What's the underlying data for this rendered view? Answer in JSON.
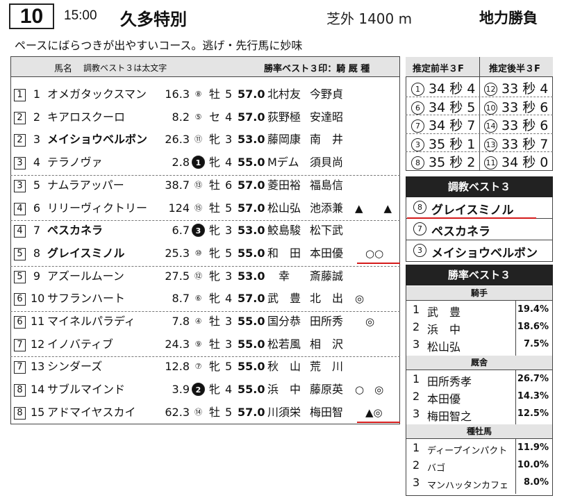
{
  "header": {
    "race_number": "10",
    "time": "15:00",
    "race_name": "久多特別",
    "course": "芝外 1400 m",
    "condition": "地力勝負"
  },
  "comment": "ペースにばらつきが出やすいコース。逃げ・先行馬に妙味",
  "table_head": {
    "left": "馬名",
    "left_sub": "調教ベスト３は太文字",
    "right": "勝率ベスト３印：騎 厩 種"
  },
  "entries": [
    {
      "waku": "1",
      "num": "1",
      "name": "オメガタックスマン",
      "bold": false,
      "odds": "16.3",
      "ninki": "⑧",
      "sex": "牡",
      "age": "5",
      "weight": "57.0",
      "jockey": "北村友",
      "trainer": "今野貞",
      "marks": ""
    },
    {
      "waku": "2",
      "num": "2",
      "name": "キアロスクーロ",
      "bold": false,
      "odds": "8.2",
      "ninki": "⑤",
      "sex": "セ",
      "age": "4",
      "weight": "57.0",
      "jockey": "荻野極",
      "trainer": "安達昭",
      "marks": ""
    },
    {
      "waku": "2",
      "num": "3",
      "name": "メイショウベルボン",
      "bold": true,
      "odds": "26.3",
      "ninki": "⑪",
      "sex": "牝",
      "age": "3",
      "weight": "53.0",
      "jockey": "藤岡康",
      "trainer": "南　井",
      "marks": ""
    },
    {
      "waku": "3",
      "num": "4",
      "name": "テラノヴァ",
      "bold": false,
      "odds": "2.8",
      "ninki": "1",
      "ninki_filled": true,
      "sex": "牝",
      "age": "4",
      "weight": "55.0",
      "jockey": "Mデム",
      "trainer": "須貝尚",
      "marks": ""
    },
    {
      "waku": "3",
      "num": "5",
      "name": "ナムラアッパー",
      "bold": false,
      "odds": "38.7",
      "ninki": "⑬",
      "sex": "牡",
      "age": "6",
      "weight": "57.0",
      "jockey": "菱田裕",
      "trainer": "福島信",
      "marks": ""
    },
    {
      "waku": "4",
      "num": "6",
      "name": "リリーヴィクトリー",
      "bold": false,
      "odds": "124",
      "ninki": "⑮",
      "sex": "牡",
      "age": "5",
      "weight": "57.0",
      "jockey": "松山弘",
      "trainer": "池添兼",
      "marks": "▲　　▲"
    },
    {
      "waku": "4",
      "num": "7",
      "name": "ペスカネラ",
      "bold": true,
      "odds": "6.7",
      "ninki": "3",
      "ninki_filled": true,
      "sex": "牝",
      "age": "3",
      "weight": "53.0",
      "jockey": "鮫島駿",
      "trainer": "松下武",
      "marks": ""
    },
    {
      "waku": "5",
      "num": "8",
      "name": "グレイスミノル",
      "bold": true,
      "odds": "25.3",
      "ninki": "⑩",
      "sex": "牝",
      "age": "5",
      "weight": "55.0",
      "jockey": "和　田",
      "trainer": "本田優",
      "marks": "　○○"
    },
    {
      "waku": "5",
      "num": "9",
      "name": "アズールムーン",
      "bold": false,
      "odds": "27.5",
      "ninki": "⑫",
      "sex": "牝",
      "age": "3",
      "weight": "53.0",
      "jockey": "　幸",
      "trainer": "斎藤誠",
      "marks": ""
    },
    {
      "waku": "6",
      "num": "10",
      "name": "サフランハート",
      "bold": false,
      "odds": "8.7",
      "ninki": "⑥",
      "sex": "牝",
      "age": "4",
      "weight": "57.0",
      "jockey": "武　豊",
      "trainer": "北　出",
      "marks": "◎"
    },
    {
      "waku": "6",
      "num": "11",
      "name": "マイネルパラディ",
      "bold": false,
      "odds": "7.8",
      "ninki": "④",
      "sex": "牡",
      "age": "3",
      "weight": "55.0",
      "jockey": "国分恭",
      "trainer": "田所秀",
      "marks": "　◎"
    },
    {
      "waku": "7",
      "num": "12",
      "name": "イノバティブ",
      "bold": false,
      "odds": "24.3",
      "ninki": "⑨",
      "sex": "牡",
      "age": "3",
      "weight": "55.0",
      "jockey": "松若風",
      "trainer": "相　沢",
      "marks": ""
    },
    {
      "waku": "7",
      "num": "13",
      "name": "シンダーズ",
      "bold": false,
      "odds": "12.8",
      "ninki": "⑦",
      "sex": "牝",
      "age": "5",
      "weight": "55.0",
      "jockey": "秋　山",
      "trainer": "荒　川",
      "marks": ""
    },
    {
      "waku": "8",
      "num": "14",
      "name": "サブルマインド",
      "bold": false,
      "odds": "3.9",
      "ninki": "2",
      "ninki_filled": true,
      "sex": "牝",
      "age": "4",
      "weight": "55.0",
      "jockey": "浜　中",
      "trainer": "藤原英",
      "marks": "○　◎"
    },
    {
      "waku": "8",
      "num": "15",
      "name": "アドマイヤスカイ",
      "bold": false,
      "odds": "62.3",
      "ninki": "⑭",
      "sex": "牡",
      "age": "5",
      "weight": "57.0",
      "jockey": "川須栄",
      "trainer": "梅田智",
      "marks": "　▲◎"
    }
  ],
  "pace": {
    "head_first": "推定前半３F",
    "head_second": "推定後半３F",
    "rows": [
      {
        "l_num": "1",
        "l_time": "34 秒 4",
        "r_num": "12",
        "r_time": "33 秒 4"
      },
      {
        "l_num": "6",
        "l_time": "34 秒 5",
        "r_num": "10",
        "r_time": "33 秒 6"
      },
      {
        "l_num": "7",
        "l_time": "34 秒 7",
        "r_num": "14",
        "r_time": "33 秒 6"
      },
      {
        "l_num": "3",
        "l_time": "35 秒 1",
        "r_num": "13",
        "r_time": "33 秒 7"
      },
      {
        "l_num": "8",
        "l_time": "35 秒 2",
        "r_num": "11",
        "r_time": "34 秒 0"
      }
    ]
  },
  "training_best": {
    "title": "調教ベスト３",
    "items": [
      {
        "num": "8",
        "name": "グレイスミノル"
      },
      {
        "num": "7",
        "name": "ペスカネラ"
      },
      {
        "num": "3",
        "name": "メイショウベルボン"
      }
    ]
  },
  "win_rate_best": {
    "title": "勝率ベスト３",
    "jockey": {
      "label": "騎手",
      "rows": [
        {
          "rank": "1",
          "name": "武　豊",
          "pct": "19.4%"
        },
        {
          "rank": "2",
          "name": "浜　中",
          "pct": "18.6%"
        },
        {
          "rank": "3",
          "name": "松山弘",
          "pct": "7.5%"
        }
      ]
    },
    "stable": {
      "label": "厩舎",
      "rows": [
        {
          "rank": "1",
          "name": "田所秀孝",
          "pct": "26.7%"
        },
        {
          "rank": "2",
          "name": "本田優",
          "pct": "14.3%"
        },
        {
          "rank": "3",
          "name": "梅田智之",
          "pct": "12.5%"
        }
      ]
    },
    "sire": {
      "label": "種牡馬",
      "rows": [
        {
          "rank": "1",
          "name": "ディープインパクト",
          "pct": "11.9%"
        },
        {
          "rank": "2",
          "name": "バゴ",
          "pct": "10.0%"
        },
        {
          "rank": "3",
          "name": "マンハッタンカフェ",
          "pct": "8.0%"
        }
      ]
    }
  },
  "colors": {
    "accent_red": "#d41a1a",
    "head_gray": "#e4e4e4",
    "dark": "#222222"
  }
}
